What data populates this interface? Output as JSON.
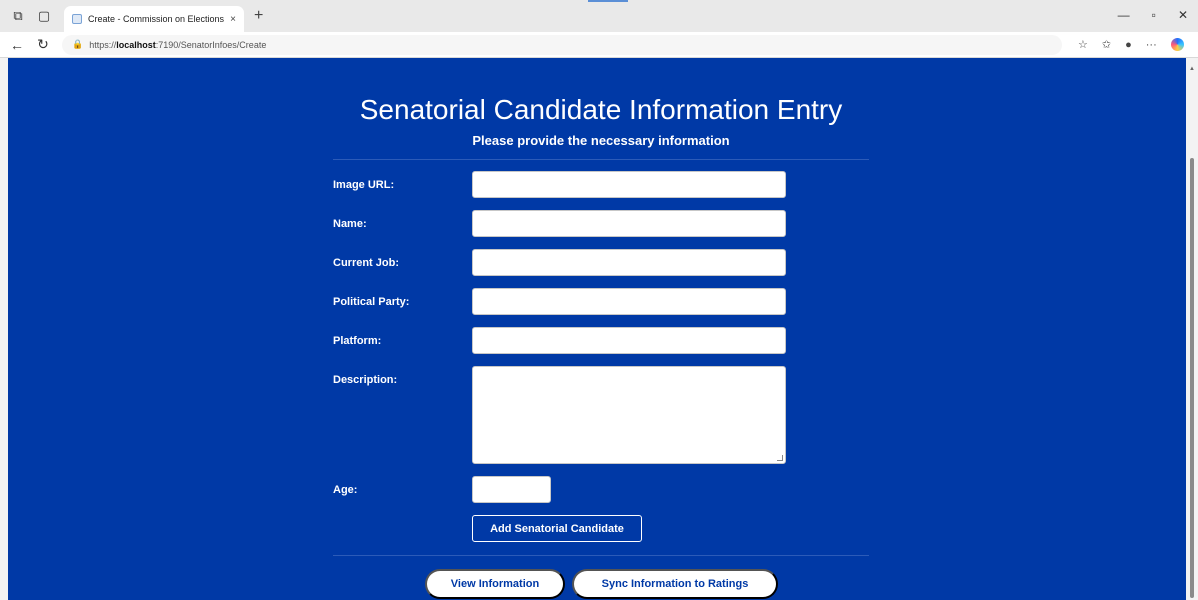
{
  "browser": {
    "tab_title": "Create - Commission on Elections",
    "tab_close": "×",
    "new_tab": "+",
    "url_prefix": "https://",
    "url_host": "localhost",
    "url_rest": ":7190/SenatorInfoes/Create"
  },
  "page": {
    "title": "Senatorial Candidate Information Entry",
    "subtitle": "Please provide the necessary information"
  },
  "form": {
    "image_url_label": "Image URL:",
    "name_label": "Name:",
    "current_job_label": "Current Job:",
    "political_party_label": "Political Party:",
    "platform_label": "Platform:",
    "description_label": "Description:",
    "age_label": "Age:",
    "submit_label": "Add Senatorial Candidate"
  },
  "actions": {
    "view_label": "View Information",
    "sync_label": "Sync Information to Ratings"
  },
  "colors": {
    "page_bg": "#0039a6",
    "text": "#ffffff"
  }
}
